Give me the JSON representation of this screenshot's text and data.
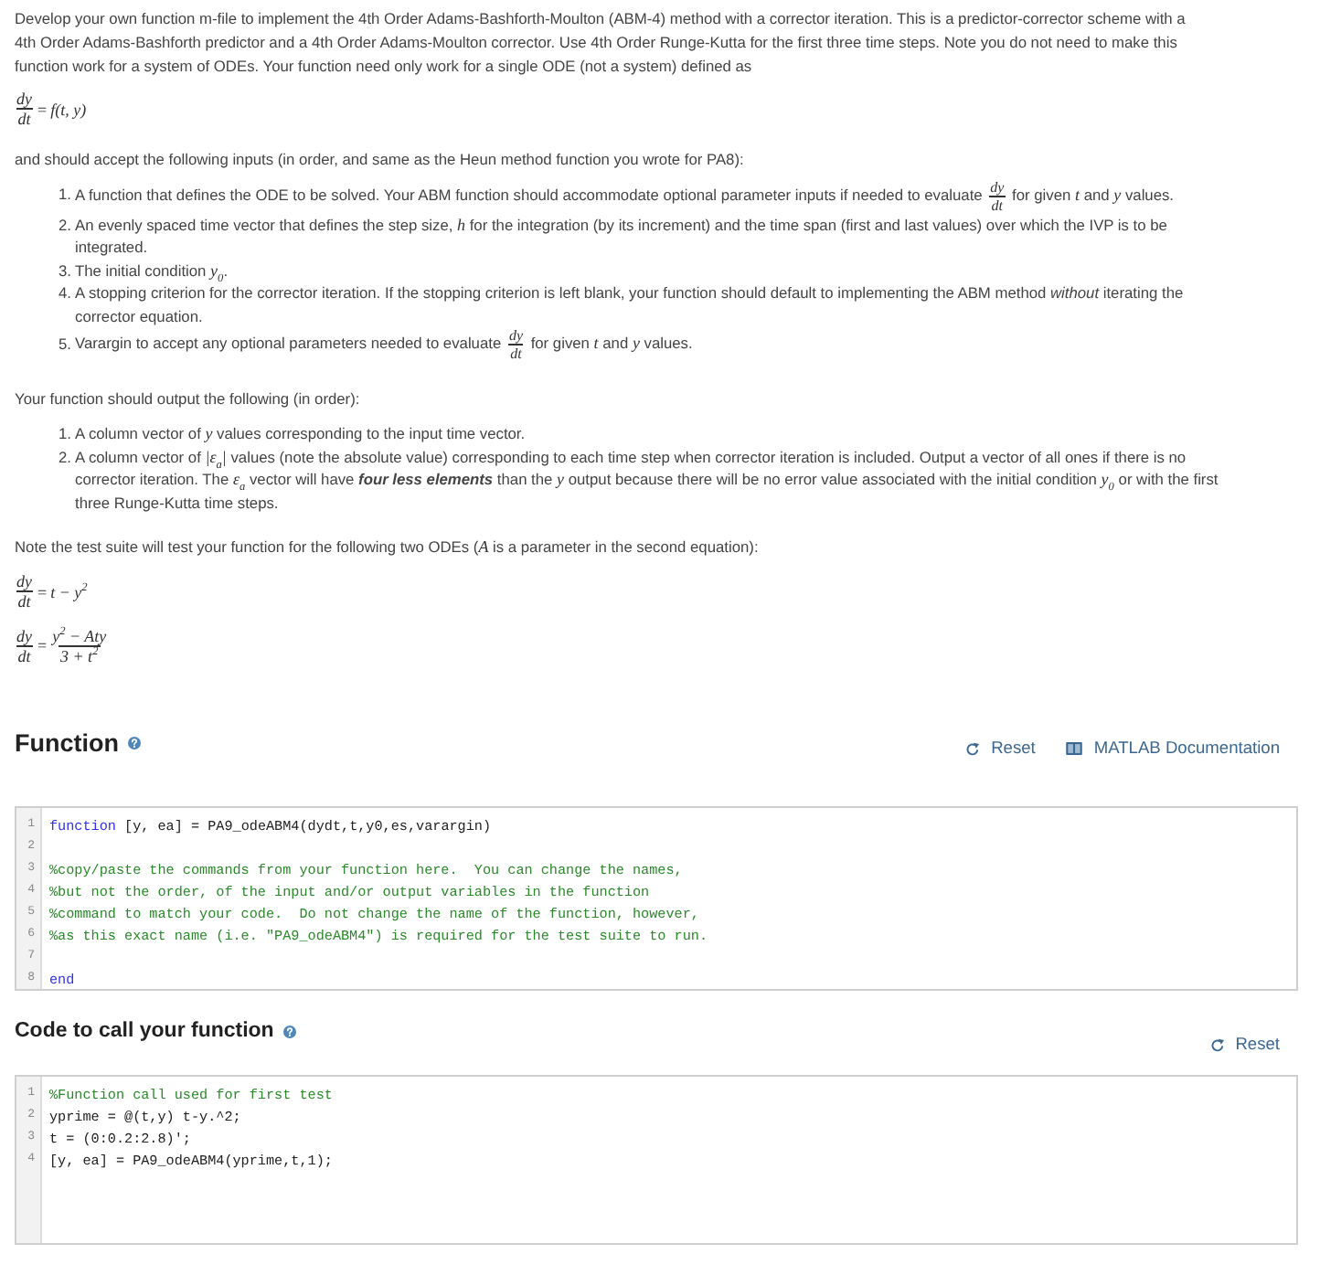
{
  "intro": "Develop your own function m-file to implement the 4th Order Adams-Bashforth-Moulton (ABM-4) method with a corrector iteration. This is a predictor-corrector scheme with a 4th Order Adams-Bashforth predictor and a 4th Order Adams-Moulton corrector. Use 4th Order Runge-Kutta for the first three time steps. Note you do not need to make this function work for a system of ODEs. Your function need only work for a single ODE (not a system) defined as",
  "ode_equation": [
    {
      "kind": "frac",
      "numerator": "dy",
      "denominator": "dt"
    },
    {
      "kind": "op",
      "text": "="
    },
    {
      "kind": "math",
      "text": "f(t, y)"
    }
  ],
  "inputs_intro": "and should accept the following inputs (in order, and same as the Heun method function you wrote for PA8):",
  "inputs": [
    {
      "number": "1.",
      "segments": [
        {
          "kind": "text",
          "text": "A function that defines the ODE to be solved. Your ABM function should accommodate optional parameter inputs if needed to evaluate "
        },
        {
          "kind": "frac",
          "numerator": "dy",
          "denominator": "dt"
        },
        {
          "kind": "text",
          "text": " for given "
        },
        {
          "kind": "math",
          "text": "t"
        },
        {
          "kind": "text",
          "text": " and "
        },
        {
          "kind": "math",
          "text": "y"
        },
        {
          "kind": "text",
          "text": " values."
        }
      ]
    },
    {
      "number": "2.",
      "segments": [
        {
          "kind": "text",
          "text": "An evenly spaced time vector that defines the step size, "
        },
        {
          "kind": "math",
          "text": "h"
        },
        {
          "kind": "text",
          "text": " for the integration (by its increment) and the time span (first and last values) over which the IVP is to be integrated."
        }
      ]
    },
    {
      "number": "3.",
      "segments": [
        {
          "kind": "text",
          "text": "The initial condition "
        },
        {
          "kind": "math",
          "text": "y$_{0}$"
        },
        {
          "kind": "text",
          "text": "."
        }
      ]
    },
    {
      "number": "4.",
      "segments": [
        {
          "kind": "text",
          "text": "A stopping criterion for the corrector iteration. If the stopping criterion is left blank, your function should default to implementing the ABM method "
        },
        {
          "kind": "italic",
          "text": "without"
        },
        {
          "kind": "text",
          "text": " iterating the corrector equation."
        }
      ]
    },
    {
      "number": "5.",
      "segments": [
        {
          "kind": "text",
          "text": "Varargin to accept any optional parameters needed to evaluate "
        },
        {
          "kind": "frac",
          "numerator": "dy",
          "denominator": "dt"
        },
        {
          "kind": "text",
          "text": " for given "
        },
        {
          "kind": "math",
          "text": "t"
        },
        {
          "kind": "text",
          "text": " and "
        },
        {
          "kind": "math",
          "text": "y"
        },
        {
          "kind": "text",
          "text": " values."
        }
      ]
    }
  ],
  "outputs_intro": "Your function should output the following (in order):",
  "outputs": [
    {
      "number": "1.",
      "segments": [
        {
          "kind": "text",
          "text": "A column vector of "
        },
        {
          "kind": "math",
          "text": "y"
        },
        {
          "kind": "text",
          "text": " values corresponding to the input time vector."
        }
      ]
    },
    {
      "number": "2.",
      "segments": [
        {
          "kind": "text",
          "text": "A column vector of "
        },
        {
          "kind": "math",
          "text": "|ε$_{a}$|"
        },
        {
          "kind": "text",
          "text": " values (note the absolute value) corresponding to each time step when corrector iteration is included. Output a vector of all ones if there is no corrector iteration. The "
        },
        {
          "kind": "math",
          "text": "ε$_{a}$"
        },
        {
          "kind": "text",
          "text": " vector will have "
        },
        {
          "kind": "bolditalic",
          "text": "four less elements"
        },
        {
          "kind": "text",
          "text": " than the "
        },
        {
          "kind": "math",
          "text": "y"
        },
        {
          "kind": "text",
          "text": " output because there will be no error value associated with the initial condition "
        },
        {
          "kind": "math",
          "text": "y$_{0}$"
        },
        {
          "kind": "text",
          "text": " or with the first three Runge-Kutta time steps."
        }
      ]
    }
  ],
  "test_note": [
    {
      "kind": "text",
      "text": "Note the test suite will test your function for the following two ODEs ("
    },
    {
      "kind": "math",
      "text": "A"
    },
    {
      "kind": "text",
      "text": " is a parameter in the second equation):"
    }
  ],
  "test_equations": [
    [
      {
        "kind": "frac",
        "numerator": "dy",
        "denominator": "dt"
      },
      {
        "kind": "op",
        "text": "="
      },
      {
        "kind": "math",
        "text": "t − y$^{2}$"
      }
    ],
    [
      {
        "kind": "frac",
        "numerator": "dy",
        "denominator": "dt"
      },
      {
        "kind": "op",
        "text": "="
      },
      {
        "kind": "frac",
        "numerator": "y$^{2}$ − Aty",
        "denominator": "3 + t$^{2}$"
      }
    ]
  ],
  "function_section": {
    "title": "Function",
    "links": [
      {
        "kind": "reset",
        "label": "Reset"
      },
      {
        "kind": "docs",
        "label": "MATLAB Documentation"
      }
    ],
    "code": [
      {
        "number": "1",
        "tokens": [
          {
            "kind": "keyword",
            "text": "function"
          },
          {
            "kind": "plain",
            "text": " [y, ea] = PA9_odeABM4(dydt,t,y0,es,varargin)"
          }
        ]
      },
      {
        "number": "2"
      },
      {
        "number": "3",
        "tokens": [
          {
            "kind": "comment",
            "text": "%copy/paste the commands from your function here.  You can change the names,"
          }
        ]
      },
      {
        "number": "4",
        "tokens": [
          {
            "kind": "comment",
            "text": "%but not the order, of the input and/or output variables in the function"
          }
        ]
      },
      {
        "number": "5",
        "tokens": [
          {
            "kind": "comment",
            "text": "%command to match your code.  Do not change the name of the function, however,"
          }
        ]
      },
      {
        "number": "6",
        "tokens": [
          {
            "kind": "comment",
            "text": "%as this exact name (i.e. \"PA9_odeABM4\") is required for the test suite to run."
          }
        ]
      },
      {
        "number": "7"
      },
      {
        "number": "8",
        "tokens": [
          {
            "kind": "keyword",
            "text": "end"
          }
        ]
      }
    ]
  },
  "call_section": {
    "title": "Code to call your function",
    "links": [
      {
        "kind": "reset",
        "label": "Reset"
      }
    ],
    "code": [
      {
        "number": "1",
        "tokens": [
          {
            "kind": "comment",
            "text": "%Function call used for first test"
          }
        ]
      },
      {
        "number": "2",
        "tokens": [
          {
            "kind": "plain",
            "text": "yprime = @(t,y) t-y.^2;"
          }
        ]
      },
      {
        "number": "3",
        "tokens": [
          {
            "kind": "plain",
            "text": "t = (0:0.2:2.8)';"
          }
        ]
      },
      {
        "number": "4",
        "tokens": [
          {
            "kind": "plain",
            "text": "[y, ea] = PA9_odeABM4(yprime,t,1);"
          }
        ]
      }
    ]
  }
}
